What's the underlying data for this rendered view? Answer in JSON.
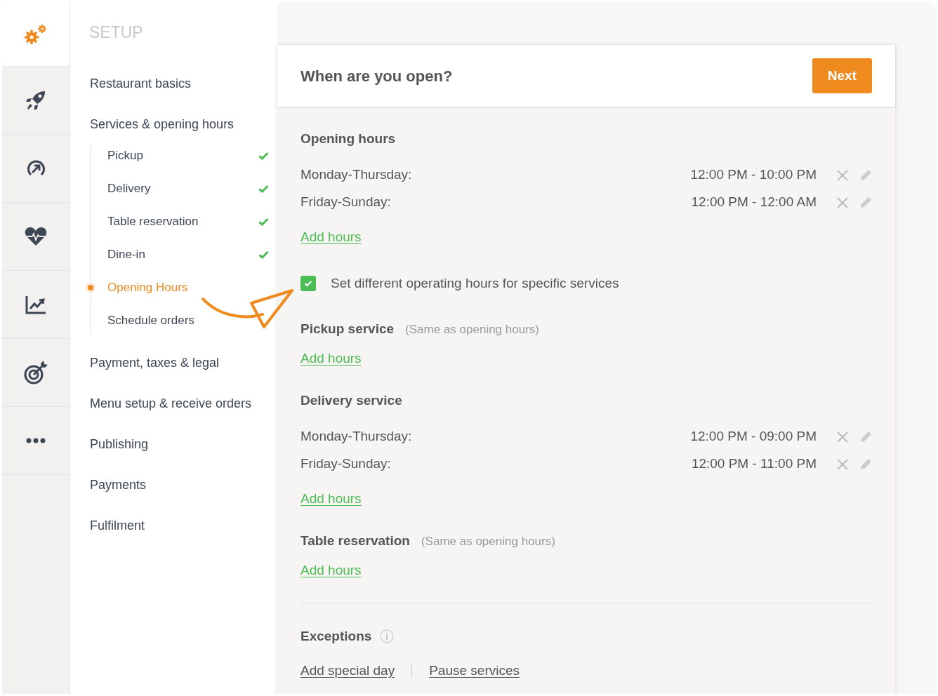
{
  "nav": {
    "heading": "SETUP",
    "items": [
      {
        "label": "Restaurant basics"
      },
      {
        "label": "Services & opening hours",
        "children": [
          {
            "label": "Pickup",
            "completed": true,
            "selected": false
          },
          {
            "label": "Delivery",
            "completed": true,
            "selected": false
          },
          {
            "label": "Table reservation",
            "completed": true,
            "selected": false
          },
          {
            "label": "Dine-in",
            "completed": true,
            "selected": false
          },
          {
            "label": "Opening Hours",
            "completed": false,
            "selected": true
          },
          {
            "label": "Schedule orders",
            "completed": false,
            "selected": false
          }
        ]
      },
      {
        "label": "Payment, taxes & legal"
      },
      {
        "label": "Menu setup & receive orders"
      },
      {
        "label": "Publishing"
      },
      {
        "label": "Payments"
      },
      {
        "label": "Fulfilment"
      }
    ]
  },
  "card": {
    "title": "When are you open?",
    "next_button": "Next",
    "opening_hours": {
      "title": "Opening hours",
      "rows": [
        {
          "days": "Monday-Thursday:",
          "hours": "12:00 PM - 10:00 PM"
        },
        {
          "days": "Friday-Sunday:",
          "hours": "12:00 PM - 12:00 AM"
        }
      ],
      "add_link": "Add hours"
    },
    "service_toggle": {
      "checked": true,
      "label": "Set different operating hours for specific services"
    },
    "services": [
      {
        "title": "Pickup service",
        "note": "(Same as opening hours)",
        "add_link": "Add hours"
      },
      {
        "title": "Delivery service",
        "rows": [
          {
            "days": "Monday-Thursday:",
            "hours": "12:00 PM - 09:00 PM"
          },
          {
            "days": "Friday-Sunday:",
            "hours": "12:00 PM - 11:00 PM"
          }
        ],
        "add_link": "Add hours"
      },
      {
        "title": "Table reservation",
        "note": "(Same as opening hours)",
        "add_link": "Add hours"
      }
    ],
    "exceptions": {
      "title": "Exceptions",
      "links": [
        "Add special day",
        "Pause services"
      ]
    }
  }
}
